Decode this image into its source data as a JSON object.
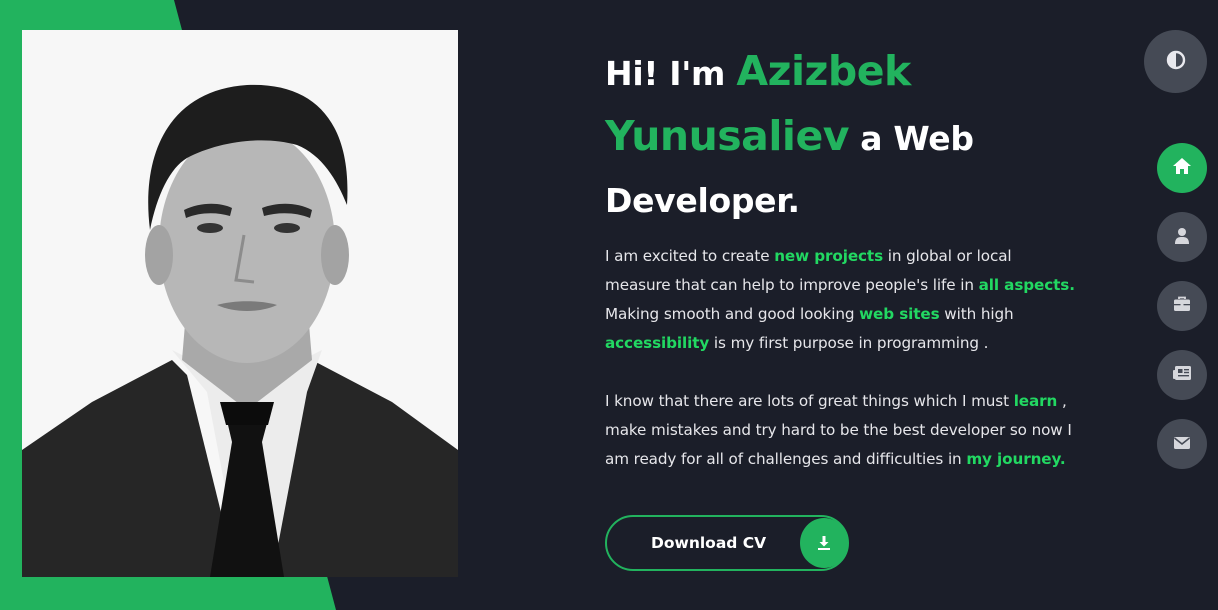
{
  "hero": {
    "greeting": "Hi! I'm",
    "name_first": "Azizbek",
    "name_last": "Yunusaliev",
    "role_prefix": "a Web",
    "role_suffix": "Developer."
  },
  "bio": {
    "p1": [
      {
        "text": "I am excited to create ",
        "hl": false
      },
      {
        "text": "new projects",
        "hl": true
      },
      {
        "text": " in global or local measure that can help to improve people's life in ",
        "hl": false
      },
      {
        "text": "all aspects.",
        "hl": true
      },
      {
        "text": " Making smooth and good looking ",
        "hl": false
      },
      {
        "text": "web sites",
        "hl": true
      },
      {
        "text": " with high ",
        "hl": false
      },
      {
        "text": "accessibility",
        "hl": true
      },
      {
        "text": " is my first purpose in programming .",
        "hl": false
      }
    ],
    "p2": [
      {
        "text": "I know that there are lots of great things which I must ",
        "hl": false
      },
      {
        "text": "learn",
        "hl": true
      },
      {
        "text": " , make mistakes and try hard to be the best developer so now I am ready for all of challenges and difficulties in ",
        "hl": false
      },
      {
        "text": "my journey.",
        "hl": true
      }
    ]
  },
  "cv_button": {
    "label": "Download CV",
    "icon": "download-icon"
  },
  "theme_toggle": {
    "icon": "contrast-icon"
  },
  "nav": [
    {
      "icon": "home-icon",
      "active": true
    },
    {
      "icon": "user-icon",
      "active": false
    },
    {
      "icon": "briefcase-icon",
      "active": false
    },
    {
      "icon": "newspaper-icon",
      "active": false
    },
    {
      "icon": "envelope-icon",
      "active": false
    }
  ],
  "colors": {
    "background": "#1b1e29",
    "accent": "#22b35e",
    "highlight": "#22d862",
    "button_gray": "#454a55"
  }
}
